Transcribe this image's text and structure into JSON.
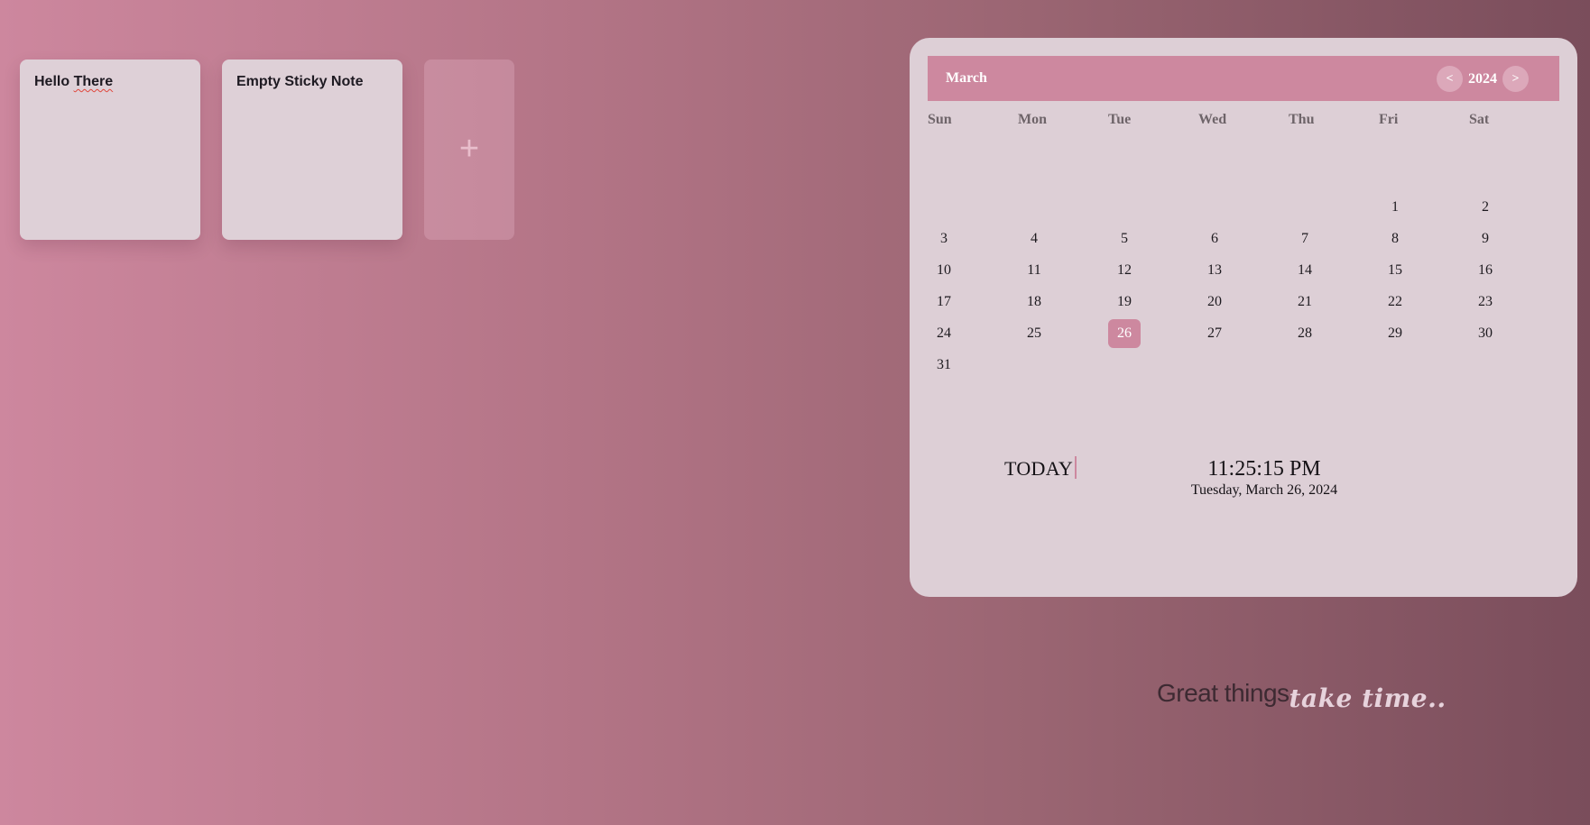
{
  "notes": [
    {
      "title_first": "Hello",
      "title_second": "There"
    },
    {
      "title": "Empty Sticky Note"
    }
  ],
  "add_note": {
    "label": "+"
  },
  "calendar": {
    "month": "March",
    "year": "2024",
    "prev_label": "<",
    "next_label": ">",
    "weekdays": [
      "Sun",
      "Mon",
      "Tue",
      "Wed",
      "Thu",
      "Fri",
      "Sat"
    ],
    "first_weekday_index": 5,
    "days_in_month": 31,
    "selected_day": 26,
    "today_label": "TODAY",
    "time": "11:25:15 PM",
    "date_full": "Tuesday, March 26, 2024"
  },
  "quote": {
    "plain": "Great things",
    "script": "take time.."
  },
  "colors": {
    "accent": "#cd889f",
    "card": "#ddcfd6",
    "note": "#ded0d7"
  }
}
